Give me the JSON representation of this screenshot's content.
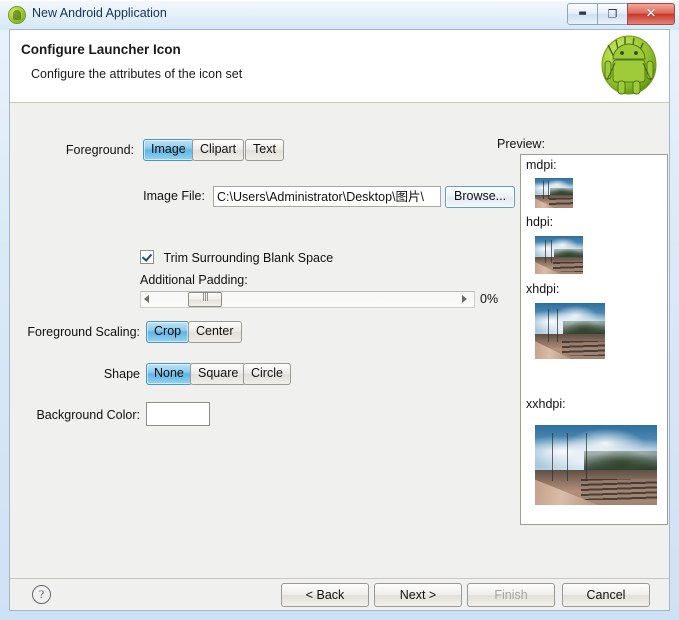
{
  "window": {
    "title": "New Android Application",
    "icon": "android-icon",
    "controls": {
      "minimize": "—",
      "maximize": "❐",
      "close": "✕"
    }
  },
  "header": {
    "title": "Configure Launcher Icon",
    "subtitle": "Configure the attributes of the icon set",
    "badge_icon": "android-robot-icon"
  },
  "form": {
    "foreground": {
      "label": "Foreground:",
      "options": [
        "Image",
        "Clipart",
        "Text"
      ],
      "selected": "Image"
    },
    "image_file": {
      "label": "Image File:",
      "value": "C:\\Users\\Administrator\\Desktop\\图片\\",
      "placeholder": "",
      "browse_label": "Browse..."
    },
    "trim": {
      "label": "Trim Surrounding Blank Space",
      "checked": true
    },
    "additional_padding": {
      "label": "Additional Padding:",
      "value": "0%",
      "min": 0,
      "max": 100,
      "current": 0,
      "left_arrow": "◄",
      "right_arrow": "►"
    },
    "foreground_scaling": {
      "label": "Foreground Scaling:",
      "options": [
        "Crop",
        "Center"
      ],
      "selected": "Crop"
    },
    "shape": {
      "label": "Shape",
      "options": [
        "None",
        "Square",
        "Circle"
      ],
      "selected": "None"
    },
    "background_color": {
      "label": "Background Color:",
      "value": "#ffffff"
    }
  },
  "preview": {
    "label": "Preview:",
    "items": [
      {
        "name": "mdpi:",
        "size": 36
      },
      {
        "name": "hdpi:",
        "size": 52
      },
      {
        "name": "xhdpi:",
        "size": 72
      },
      {
        "name": "xxhdpi:",
        "size": 104
      }
    ]
  },
  "footer": {
    "help_icon": "help-question-icon",
    "buttons": [
      {
        "label": "< Back",
        "enabled": true
      },
      {
        "label": "Next >",
        "enabled": true
      },
      {
        "label": "Finish",
        "enabled": false
      },
      {
        "label": "Cancel",
        "enabled": true
      }
    ]
  },
  "colors": {
    "selected_toggle": "#6fbfe6",
    "accent_border": "#4d93c4",
    "window_frame": "#cfe1f4",
    "close_button": "#c8382c"
  }
}
